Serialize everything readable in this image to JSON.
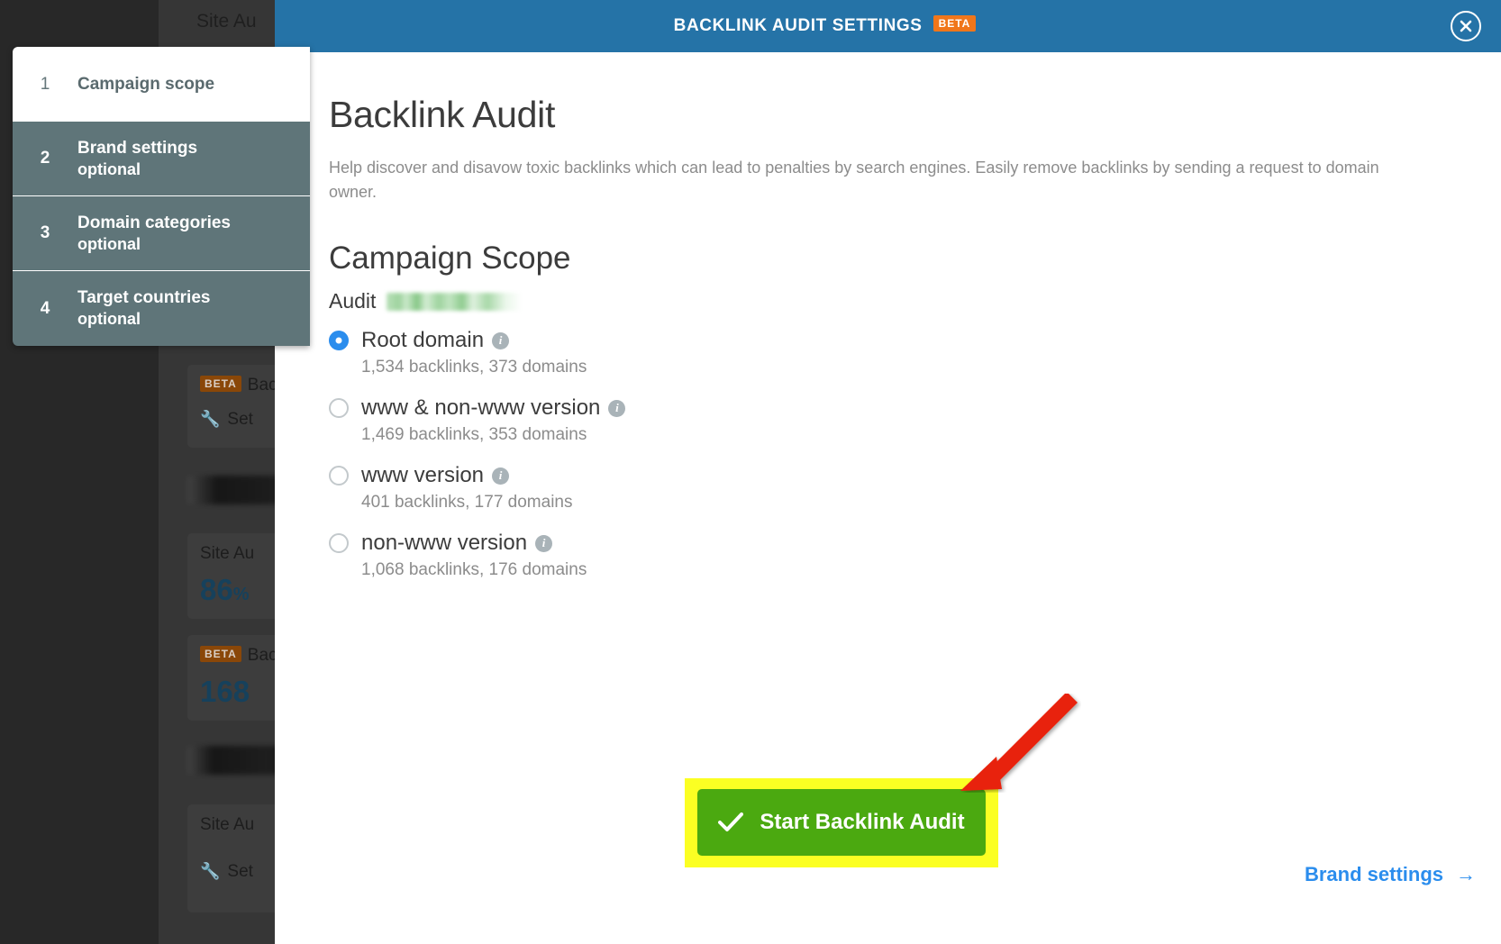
{
  "background": {
    "cards": [
      {
        "beta": "BETA",
        "title": "Bac",
        "sub": "Set",
        "icon": "wrench-icon"
      },
      {
        "title": "Site Au",
        "metric": "86",
        "metric_unit": "%"
      },
      {
        "beta": "BETA",
        "title": "Bac",
        "metric": "168"
      },
      {
        "title": "Site Au"
      }
    ],
    "top_label": "Site Au",
    "redacted_labels": [
      "",
      "|!"
    ]
  },
  "header": {
    "title": "BACKLINK AUDIT SETTINGS",
    "beta_badge": "BETA",
    "close_icon": "close-icon",
    "bg_color": "#2573a7"
  },
  "steps": [
    {
      "num": "1",
      "title": "Campaign scope",
      "optional": "",
      "active": true
    },
    {
      "num": "2",
      "title": "Brand settings",
      "optional": "optional",
      "active": false
    },
    {
      "num": "3",
      "title": "Domain categories",
      "optional": "optional",
      "active": false
    },
    {
      "num": "4",
      "title": "Target countries",
      "optional": "optional",
      "active": false
    }
  ],
  "main": {
    "page_title": "Backlink Audit",
    "page_desc": "Help discover and disavow toxic backlinks which can lead to penalties by search engines. Easily remove backlinks by sending a request to domain owner.",
    "section_title": "Campaign Scope",
    "audit_label": "Audit",
    "audit_value_redacted": true,
    "options": [
      {
        "label": "Root domain",
        "sub": "1,534 backlinks, 373 domains",
        "checked": true,
        "info": "i"
      },
      {
        "label": "www & non-www version",
        "sub": "1,469 backlinks, 353 domains",
        "checked": false,
        "info": "i"
      },
      {
        "label": "www version",
        "sub": "401 backlinks, 177 domains",
        "checked": false,
        "info": "i"
      },
      {
        "label": "non-www version",
        "sub": "1,068 backlinks, 176 domains",
        "checked": false,
        "info": "i"
      }
    ]
  },
  "footer": {
    "start_button_label": "Start Backlink Audit",
    "start_button_icon": "check-icon",
    "start_button_color": "#4ba910",
    "highlight_color": "#fbff23",
    "brand_settings_label": "Brand settings",
    "brand_settings_arrow": "→",
    "brand_settings_color": "#2b8ded"
  },
  "annotation": {
    "arrow_color": "#e8210a",
    "arrow_name": "red-pointer-arrow"
  }
}
